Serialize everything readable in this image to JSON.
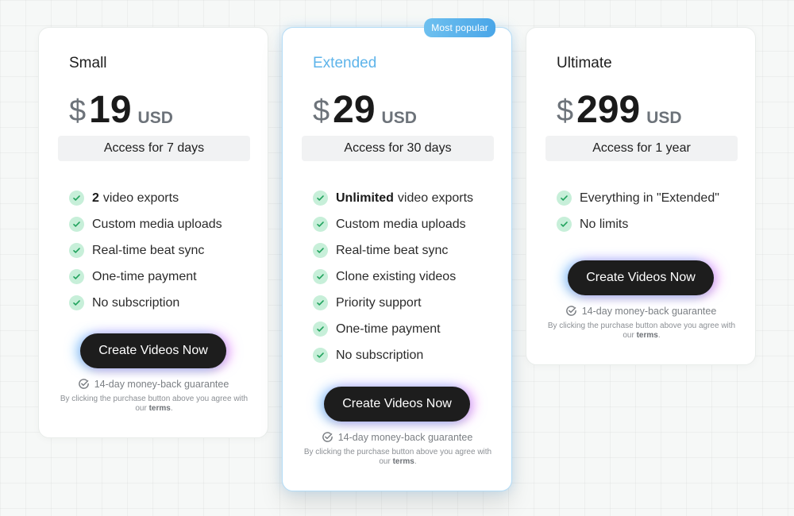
{
  "plans": [
    {
      "name": "Small",
      "currency_symbol": "$",
      "price": "19",
      "currency": "USD",
      "access": "Access for 7 days",
      "features": [
        {
          "strong": "2",
          "text": "video exports"
        },
        {
          "strong": "",
          "text": "Custom media uploads"
        },
        {
          "strong": "",
          "text": "Real-time beat sync"
        },
        {
          "strong": "",
          "text": "One-time payment"
        },
        {
          "strong": "",
          "text": "No subscription"
        }
      ],
      "cta": "Create Videos Now",
      "guarantee": "14-day money-back guarantee",
      "terms_prefix": "By clicking the purchase button above you agree with our",
      "terms_link": "terms",
      "terms_suffix": "."
    },
    {
      "name": "Extended",
      "badge": "Most popular",
      "currency_symbol": "$",
      "price": "29",
      "currency": "USD",
      "access": "Access for 30 days",
      "features": [
        {
          "strong": "Unlimited",
          "text": "video exports"
        },
        {
          "strong": "",
          "text": "Custom media uploads"
        },
        {
          "strong": "",
          "text": "Real-time beat sync"
        },
        {
          "strong": "",
          "text": "Clone existing videos"
        },
        {
          "strong": "",
          "text": "Priority support"
        },
        {
          "strong": "",
          "text": "One-time payment"
        },
        {
          "strong": "",
          "text": "No subscription"
        }
      ],
      "cta": "Create Videos Now",
      "guarantee": "14-day money-back guarantee",
      "terms_prefix": "By clicking the purchase button above you agree with our",
      "terms_link": "terms",
      "terms_suffix": "."
    },
    {
      "name": "Ultimate",
      "currency_symbol": "$",
      "price": "299",
      "currency": "USD",
      "access": "Access for 1 year",
      "features": [
        {
          "strong": "",
          "text": "Everything in \"Extended\""
        },
        {
          "strong": "",
          "text": "No limits"
        }
      ],
      "cta": "Create Videos Now",
      "guarantee": "14-day money-back guarantee",
      "terms_prefix": "By clicking the purchase button above you agree with our",
      "terms_link": "terms",
      "terms_suffix": "."
    }
  ],
  "colors": {
    "accent": "#5eb4ea",
    "check_bg": "#c7efd9",
    "check_mark": "#22a35e",
    "button_bg": "#1d1d1d"
  },
  "icons": {
    "feature_check": "check-circle-icon",
    "guarantee": "circle-check-outline-icon"
  }
}
